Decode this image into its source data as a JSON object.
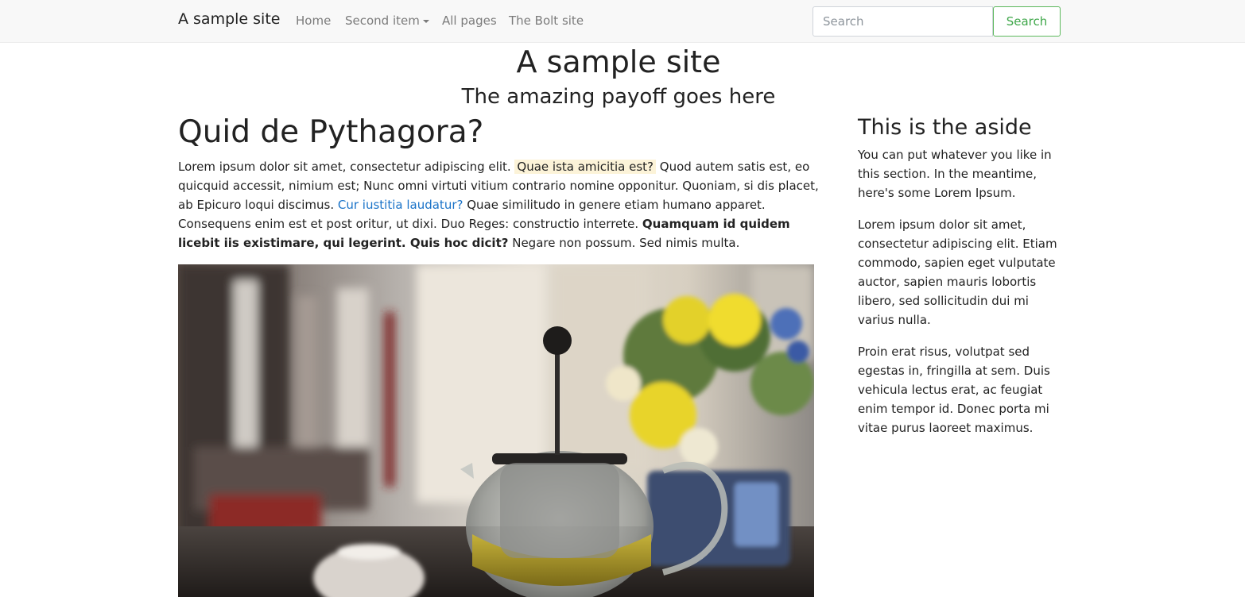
{
  "navbar": {
    "brand": "A sample site",
    "items": [
      {
        "label": "Home"
      },
      {
        "label": "Second item"
      },
      {
        "label": "All pages"
      },
      {
        "label": "The Bolt site"
      }
    ],
    "search": {
      "placeholder": "Search",
      "button_label": "Search"
    }
  },
  "header": {
    "title": "A sample site",
    "tagline": "The amazing payoff goes here"
  },
  "article": {
    "title": "Quid de Pythagora?",
    "segments": [
      "Lorem ipsum dolor sit amet, consectetur adipiscing elit. ",
      "Quae ista amicitia est?",
      " Quod autem satis est, eo quicquid accessit, nimium est; Nunc omni virtuti vitium contrario nomine opponitur. Quoniam, si dis placet, ab Epicuro loqui discimus. ",
      "Cur iustitia laudatur?",
      " Quae similitudo in genere etiam humano apparet. Consequens enim est et post oritur, ut dixi. Duo Reges: constructio interrete. ",
      "Quamquam id quidem licebit iis existimare, qui legerint. Quis hoc dicit?",
      " Negare non possum. Sed nimis multa."
    ]
  },
  "aside": {
    "title": "This is the aside",
    "paragraphs": [
      "You can put whatever you like in this section. In the meantime, here's some Lorem Ipsum.",
      "Lorem ipsum dolor sit amet, consectetur adipiscing elit. Etiam commodo, sapien eget vulputate auctor, sapien mauris lobortis libero, sed sollicitudin dui mi varius nulla.",
      "Proin erat risus, volutpat sed egestas in, fringilla at sem. Duis vehicula lectus erat, ac feugiat enim tempor id. Donec porta mi vitae purus laoreet maximus."
    ]
  },
  "colors": {
    "navbar_bg": "#f8f8f8",
    "link": "#1a73c8",
    "success": "#5cb85c",
    "highlight": "#fcf3d8"
  }
}
